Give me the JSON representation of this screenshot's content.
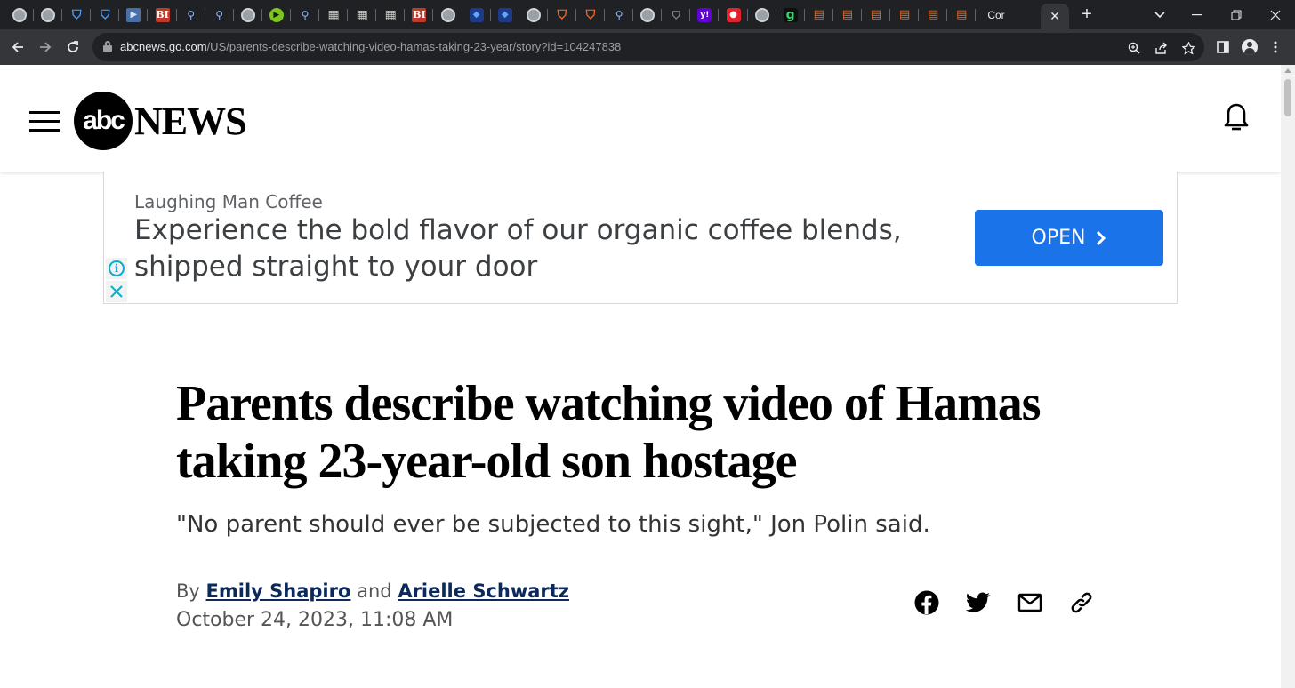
{
  "browser": {
    "url_host": "abcnews.go.com",
    "url_path": "/US/parents-describe-watching-video-hamas-taking-23-year/story?id=104247838",
    "active_tab_title": "Cor",
    "tab_favicons": [
      "globe",
      "globe",
      "shield",
      "shield",
      "flag",
      "bi",
      "search",
      "search",
      "globe",
      "play",
      "search",
      "book",
      "book",
      "book",
      "bi",
      "globe",
      "cube",
      "cube",
      "globe",
      "orange-shield",
      "orange-shield",
      "search",
      "globe",
      "shield-gray",
      "yahoo",
      "mic",
      "globe",
      "g",
      "substack",
      "substack",
      "substack",
      "substack",
      "substack",
      "substack"
    ],
    "icons": {
      "back": "arrow-left-icon",
      "forward": "arrow-right-icon",
      "reload": "reload-icon",
      "zoom": "zoom-icon",
      "share": "share-icon",
      "bookmark": "star-icon",
      "sidepanel": "side-panel-icon",
      "profile": "profile-icon",
      "menu": "kebab-menu-icon"
    }
  },
  "site": {
    "logo_circle": "abc",
    "logo_text": "NEWS"
  },
  "ad": {
    "brand": "Laughing Man Coffee",
    "headline": "Experience the bold flavor of our organic coffee blends, shipped straight to your door",
    "cta": "OPEN",
    "accent": "#1a73e8"
  },
  "article": {
    "headline": "Parents describe watching video of Hamas taking 23-year-old son hostage",
    "subhead": "\"No parent should ever be subjected to this sight,\" Jon Polin said.",
    "byline_prefix": "By",
    "author_1": "Emily Shapiro",
    "byline_join": "and",
    "author_2": "Arielle Schwartz",
    "date": "October 24, 2023, 11:08 AM"
  }
}
